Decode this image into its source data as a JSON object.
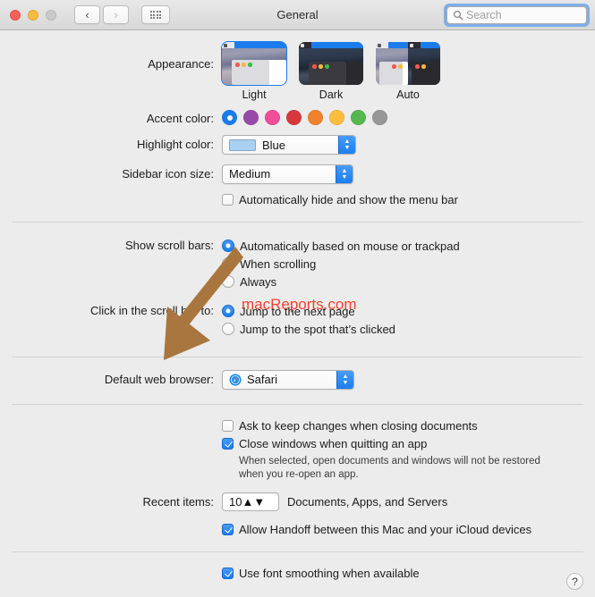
{
  "window": {
    "title": "General",
    "traffic_lights": [
      "close-red",
      "minimize-yellow",
      "zoom-disabled-gray"
    ],
    "nav": {
      "back_label": "‹",
      "forward_label": "›"
    },
    "grid_button": "show-all-grid-icon"
  },
  "search": {
    "placeholder": "Search",
    "icon": "search-icon",
    "focused": true,
    "focus_ring_color": "#7eaeea"
  },
  "appearance": {
    "label": "Appearance:",
    "options": [
      {
        "name": "Light",
        "selected": true
      },
      {
        "name": "Dark",
        "selected": false
      },
      {
        "name": "Auto",
        "selected": false
      }
    ]
  },
  "accent_color": {
    "label": "Accent color:",
    "selected_index": 0,
    "swatches": [
      {
        "name": "blue",
        "hex": "#197ced"
      },
      {
        "name": "purple",
        "hex": "#9849a8"
      },
      {
        "name": "pink",
        "hex": "#f04e98"
      },
      {
        "name": "red",
        "hex": "#d6393c"
      },
      {
        "name": "orange",
        "hex": "#f0822c"
      },
      {
        "name": "yellow",
        "hex": "#fcbd3e"
      },
      {
        "name": "green",
        "hex": "#54b74f"
      },
      {
        "name": "graphite",
        "hex": "#979797"
      }
    ]
  },
  "highlight_color": {
    "label": "Highlight color:",
    "value": "Blue",
    "swatch_hex": "#a9d0f0"
  },
  "sidebar_icon_size": {
    "label": "Sidebar icon size:",
    "value": "Medium"
  },
  "auto_hide_menu_bar": {
    "label": "Automatically hide and show the menu bar",
    "checked": false
  },
  "show_scroll_bars": {
    "label": "Show scroll bars:",
    "options": [
      {
        "label": "Automatically based on mouse or trackpad",
        "selected": true
      },
      {
        "label": "When scrolling",
        "selected": false
      },
      {
        "label": "Always",
        "selected": false
      }
    ]
  },
  "click_scroll_bar": {
    "label": "Click in the scroll bar to:",
    "options": [
      {
        "label": "Jump to the next page",
        "selected": true
      },
      {
        "label": "Jump to the spot that’s clicked",
        "selected": false
      }
    ]
  },
  "default_web_browser": {
    "label": "Default web browser:",
    "value": "Safari",
    "icon": "safari-compass-icon"
  },
  "document_options": [
    {
      "label": "Ask to keep changes when closing documents",
      "checked": false
    },
    {
      "label": "Close windows when quitting an app",
      "checked": true
    }
  ],
  "document_hint": "When selected, open documents and windows will not be restored when you re-open an app.",
  "recent_items": {
    "label": "Recent items:",
    "value": "10",
    "suffix": "Documents, Apps, and Servers"
  },
  "handoff": {
    "label": "Allow Handoff between this Mac and your iCloud devices",
    "checked": true
  },
  "font_smoothing": {
    "label": "Use font smoothing when available",
    "checked": true
  },
  "help_button": {
    "label": "?"
  },
  "annotations": {
    "watermark_text": "macReports.com",
    "watermark_color": "#f4402e",
    "arrow_color": "#a9763f",
    "arrow_name": "pointer-arrow-annotation"
  }
}
